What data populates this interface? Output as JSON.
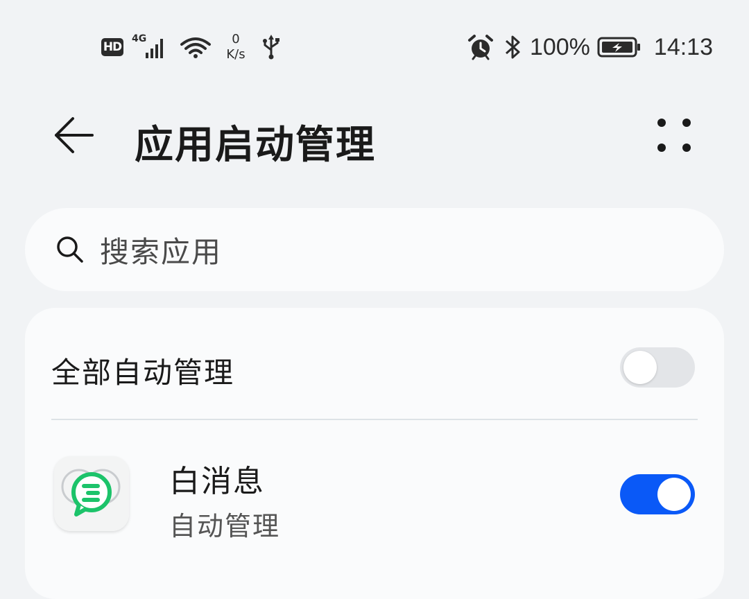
{
  "status_bar": {
    "hd_label": "HD",
    "network_label": "4G",
    "net_speed_value": "0",
    "net_speed_unit": "K/s",
    "battery_percent": "100%",
    "time": "14:13",
    "icons": [
      "hd-icon",
      "signal-icon",
      "wifi-icon",
      "usb-icon",
      "alarm-icon",
      "bluetooth-icon",
      "battery-charging-icon"
    ]
  },
  "header": {
    "title": "应用启动管理",
    "back_icon": "back-arrow-icon",
    "more_icon": "more-icon"
  },
  "search": {
    "placeholder": "搜索应用",
    "icon": "search-icon"
  },
  "manage_all": {
    "label": "全部自动管理",
    "enabled": false
  },
  "apps": [
    {
      "name": "白消息",
      "status": "自动管理",
      "enabled": true,
      "icon": "app-icon-white-message"
    }
  ],
  "colors": {
    "background": "#f1f3f5",
    "card": "#fafbfc",
    "accent": "#0a59f7",
    "toggle_off": "#e3e5e8",
    "app_icon_green": "#1cc36a"
  }
}
